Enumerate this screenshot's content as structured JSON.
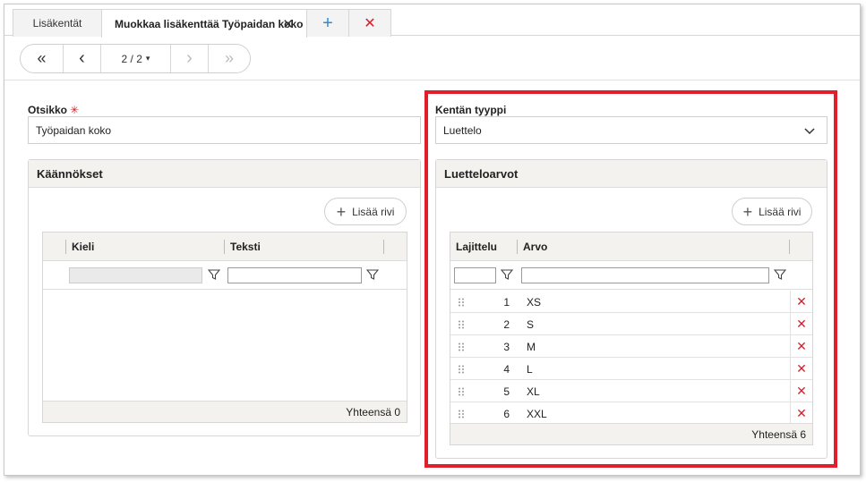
{
  "tabs": [
    {
      "label": "Lisäkentät"
    },
    {
      "label": "Muokkaa lisäkenttää Työpaidan koko",
      "close": "✕"
    },
    {
      "label": "+"
    },
    {
      "label": "✕"
    }
  ],
  "pager": {
    "first": "«",
    "prev": "‹",
    "page": "2 / 2",
    "page_arrow": "▾",
    "next": "›",
    "last": "»"
  },
  "otsikko": {
    "label": "Otsikko",
    "required": "✳",
    "value": "Työpaidan koko"
  },
  "kentan_tyyppi": {
    "label": "Kentän tyyppi",
    "value": "Luettelo"
  },
  "kaannokset": {
    "title": "Käännökset",
    "add_button": "Lisää rivi",
    "columns": [
      "Kieli",
      "Teksti"
    ],
    "footer": "Yhteensä 0"
  },
  "luetteloarvot": {
    "title": "Luetteloarvot",
    "add_button": "Lisää rivi",
    "columns": [
      "Lajittelu",
      "Arvo"
    ],
    "rows": [
      {
        "order": "1",
        "value": "XS"
      },
      {
        "order": "2",
        "value": "S"
      },
      {
        "order": "3",
        "value": "M"
      },
      {
        "order": "4",
        "value": "L"
      },
      {
        "order": "5",
        "value": "XL"
      },
      {
        "order": "6",
        "value": "XXL"
      }
    ],
    "footer": "Yhteensä 6"
  },
  "colors": {
    "accent_blue": "#2d8ad6",
    "delete_red": "#d3212d",
    "highlight_red": "#e21e2c"
  }
}
